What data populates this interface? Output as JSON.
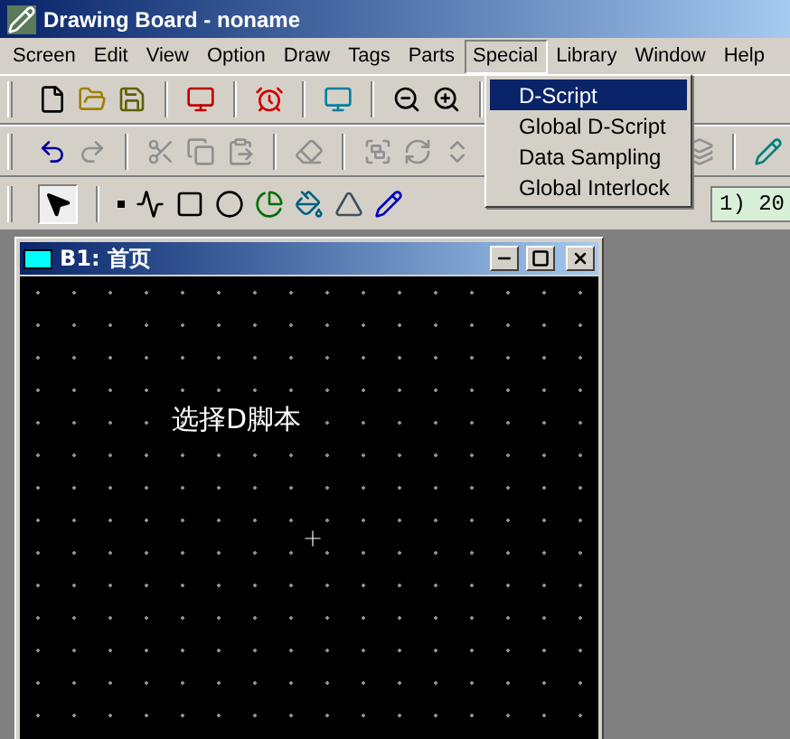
{
  "window": {
    "title": "Drawing Board - noname"
  },
  "menu": [
    {
      "label": "Screen",
      "selected": false
    },
    {
      "label": "Edit",
      "selected": false
    },
    {
      "label": "View",
      "selected": false
    },
    {
      "label": "Option",
      "selected": false
    },
    {
      "label": "Draw",
      "selected": false
    },
    {
      "label": "Tags",
      "selected": false
    },
    {
      "label": "Parts",
      "selected": false
    },
    {
      "label": "Special",
      "selected": true
    },
    {
      "label": "Library",
      "selected": false
    },
    {
      "label": "Window",
      "selected": false
    },
    {
      "label": "Help",
      "selected": false
    }
  ],
  "dropdown": [
    {
      "label": "D-Script",
      "selected": true
    },
    {
      "label": "Global D-Script",
      "selected": false
    },
    {
      "label": "Data Sampling",
      "selected": false
    },
    {
      "label": "Global Interlock",
      "selected": false
    }
  ],
  "toolbar": {
    "field": "1) 20"
  },
  "child_window": {
    "title": "B1: 首页",
    "canvas_text": "选择D脚本"
  }
}
